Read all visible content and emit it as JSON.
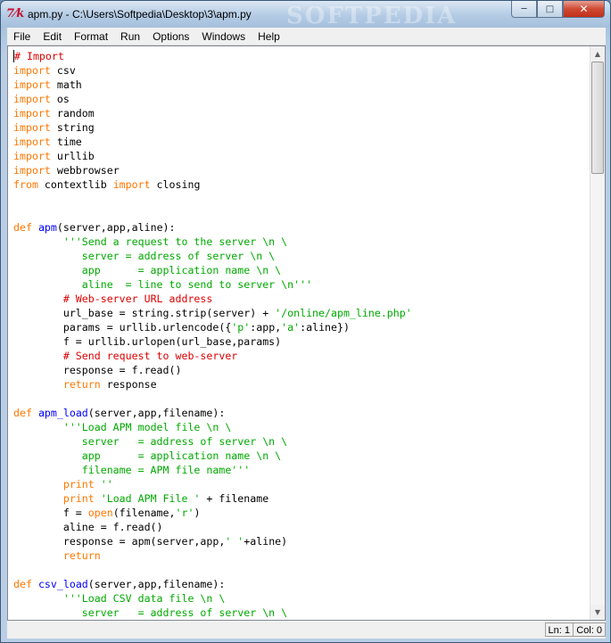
{
  "window": {
    "title": "apm.py - C:\\Users\\Softpedia\\Desktop\\3\\apm.py",
    "watermark": "SOFTPEDIA"
  },
  "menu": [
    "File",
    "Edit",
    "Format",
    "Run",
    "Options",
    "Windows",
    "Help"
  ],
  "code_lines": [
    [
      [
        "com",
        "# Import"
      ]
    ],
    [
      [
        "kw",
        "import"
      ],
      [
        "n",
        " csv"
      ]
    ],
    [
      [
        "kw",
        "import"
      ],
      [
        "n",
        " math"
      ]
    ],
    [
      [
        "kw",
        "import"
      ],
      [
        "n",
        " os"
      ]
    ],
    [
      [
        "kw",
        "import"
      ],
      [
        "n",
        " random"
      ]
    ],
    [
      [
        "kw",
        "import"
      ],
      [
        "n",
        " string"
      ]
    ],
    [
      [
        "kw",
        "import"
      ],
      [
        "n",
        " time"
      ]
    ],
    [
      [
        "kw",
        "import"
      ],
      [
        "n",
        " urllib"
      ]
    ],
    [
      [
        "kw",
        "import"
      ],
      [
        "n",
        " webbrowser"
      ]
    ],
    [
      [
        "kw",
        "from"
      ],
      [
        "n",
        " contextlib "
      ],
      [
        "kw",
        "import"
      ],
      [
        "n",
        " closing"
      ]
    ],
    [],
    [],
    [
      [
        "kw",
        "def"
      ],
      [
        "n",
        " "
      ],
      [
        "def",
        "apm"
      ],
      [
        "n",
        "(server,app,aline):"
      ]
    ],
    [
      [
        "n",
        "        "
      ],
      [
        "str",
        "'''Send a request to the server \\n \\"
      ]
    ],
    [
      [
        "str",
        "           server = address of server \\n \\"
      ]
    ],
    [
      [
        "str",
        "           app      = application name \\n \\"
      ]
    ],
    [
      [
        "str",
        "           aline  = line to send to server \\n'''"
      ]
    ],
    [
      [
        "n",
        "        "
      ],
      [
        "com",
        "# Web-server URL address"
      ]
    ],
    [
      [
        "n",
        "        url_base = string.strip(server) + "
      ],
      [
        "str",
        "'/online/apm_line.php'"
      ]
    ],
    [
      [
        "n",
        "        params = urllib.urlencode({"
      ],
      [
        "str",
        "'p'"
      ],
      [
        "n",
        ":app,"
      ],
      [
        "str",
        "'a'"
      ],
      [
        "n",
        ":aline})"
      ]
    ],
    [
      [
        "n",
        "        f = urllib.urlopen(url_base,params)"
      ]
    ],
    [
      [
        "n",
        "        "
      ],
      [
        "com",
        "# Send request to web-server"
      ]
    ],
    [
      [
        "n",
        "        response = f.read()"
      ]
    ],
    [
      [
        "n",
        "        "
      ],
      [
        "kw",
        "return"
      ],
      [
        "n",
        " response"
      ]
    ],
    [],
    [
      [
        "kw",
        "def"
      ],
      [
        "n",
        " "
      ],
      [
        "def",
        "apm_load"
      ],
      [
        "n",
        "(server,app,filename):"
      ]
    ],
    [
      [
        "n",
        "        "
      ],
      [
        "str",
        "'''Load APM model file \\n \\"
      ]
    ],
    [
      [
        "str",
        "           server   = address of server \\n \\"
      ]
    ],
    [
      [
        "str",
        "           app      = application name \\n \\"
      ]
    ],
    [
      [
        "str",
        "           filename = APM file name'''"
      ]
    ],
    [
      [
        "n",
        "        "
      ],
      [
        "kw",
        "print"
      ],
      [
        "n",
        " "
      ],
      [
        "str",
        "''"
      ]
    ],
    [
      [
        "n",
        "        "
      ],
      [
        "kw",
        "print"
      ],
      [
        "n",
        " "
      ],
      [
        "str",
        "'Load APM File '"
      ],
      [
        "n",
        " + filename"
      ]
    ],
    [
      [
        "n",
        "        f = "
      ],
      [
        "kw",
        "open"
      ],
      [
        "n",
        "(filename,"
      ],
      [
        "str",
        "'r'"
      ],
      [
        "n",
        ")"
      ]
    ],
    [
      [
        "n",
        "        aline = f.read()"
      ]
    ],
    [
      [
        "n",
        "        response = apm(server,app,"
      ],
      [
        "str",
        "' '"
      ],
      [
        "n",
        "+aline)"
      ]
    ],
    [
      [
        "n",
        "        "
      ],
      [
        "kw",
        "return"
      ]
    ],
    [],
    [
      [
        "kw",
        "def"
      ],
      [
        "n",
        " "
      ],
      [
        "def",
        "csv_load"
      ],
      [
        "n",
        "(server,app,filename):"
      ]
    ],
    [
      [
        "n",
        "        "
      ],
      [
        "str",
        "'''Load CSV data file \\n \\"
      ]
    ],
    [
      [
        "str",
        "           server   = address of server \\n \\"
      ]
    ]
  ],
  "status": {
    "line": "Ln: 1",
    "col": "Col: 0"
  },
  "colors": {
    "keyword": "#ff7700",
    "definition": "#0000ff",
    "string": "#00aa00",
    "comment": "#dd0000"
  }
}
